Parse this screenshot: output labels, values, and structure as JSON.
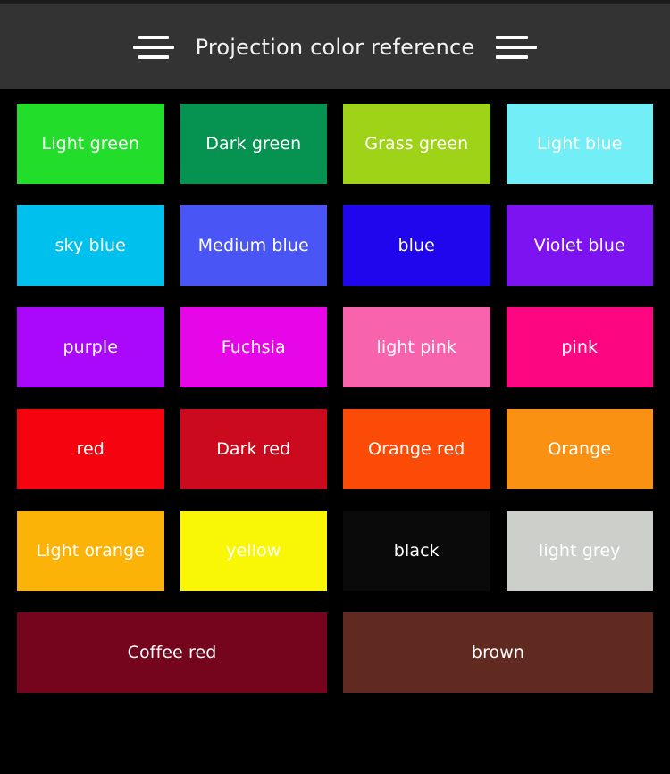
{
  "header": {
    "title": "Projection color reference",
    "left_icon": "menu-lines-icon",
    "right_icon": "menu-lines-icon"
  },
  "theme": {
    "page_background": "#000000",
    "header_background": "#333333",
    "header_text": "#f2f2f2",
    "swatch_label_text": "#ffffff"
  },
  "palette": {
    "rows": [
      {
        "swatches": [
          {
            "label": "Light green",
            "color": "#22DD2A"
          },
          {
            "label": "Dark green",
            "color": "#069352"
          },
          {
            "label": "Grass green",
            "color": "#9ED318"
          },
          {
            "label": "Light blue",
            "color": "#72EEF7"
          }
        ]
      },
      {
        "swatches": [
          {
            "label": "sky blue",
            "color": "#00C0EE"
          },
          {
            "label": "Medium blue",
            "color": "#4A55F5"
          },
          {
            "label": "blue",
            "color": "#1F06ED"
          },
          {
            "label": "Violet blue",
            "color": "#7C13F0"
          }
        ]
      },
      {
        "swatches": [
          {
            "label": "purple",
            "color": "#AA08FA"
          },
          {
            "label": "Fuchsia",
            "color": "#E706E7"
          },
          {
            "label": "light pink",
            "color": "#F863AD"
          },
          {
            "label": "pink",
            "color": "#FC0681"
          }
        ]
      },
      {
        "swatches": [
          {
            "label": "red",
            "color": "#F60310"
          },
          {
            "label": "Dark red",
            "color": "#CC0A1E"
          },
          {
            "label": "Orange red",
            "color": "#FB4B07"
          },
          {
            "label": "Orange",
            "color": "#FA9112"
          }
        ]
      },
      {
        "swatches": [
          {
            "label": "Light orange",
            "color": "#FCB307"
          },
          {
            "label": "yellow",
            "color": "#FAF706"
          },
          {
            "label": "black",
            "color": "#0A0A0A"
          },
          {
            "label": "light grey",
            "color": "#CDCFCB"
          }
        ]
      },
      {
        "wide": true,
        "swatches": [
          {
            "label": "Coffee red",
            "color": "#74051C"
          },
          {
            "label": "brown",
            "color": "#612A20"
          }
        ]
      }
    ]
  }
}
